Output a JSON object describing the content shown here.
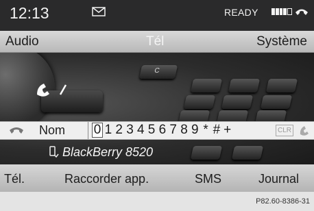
{
  "status": {
    "time": "12:13",
    "ready": "READY",
    "signal_icon": "signal-bars-icon",
    "mail_icon": "envelope-icon",
    "phone_icon": "handset-icon"
  },
  "menu": {
    "left": "Audio",
    "center": "Tél",
    "right": "Système"
  },
  "keypad": {
    "label": "Nom",
    "keys": [
      "0",
      "1",
      "2",
      "3",
      "4",
      "5",
      "6",
      "7",
      "8",
      "9",
      "*",
      "#",
      "+"
    ],
    "selected_index": 0,
    "clear_label": "CLR"
  },
  "device": {
    "name": "BlackBerry 8520"
  },
  "bottom": {
    "items": [
      "Tél.",
      "Raccorder app.",
      "SMS",
      "Journal"
    ]
  },
  "reference": "P82.60-8386-31",
  "colors": {
    "status_bg": "#2a2a2b",
    "menu_bg": "#c8c8c8",
    "keyrow_bg": "#efefef"
  }
}
